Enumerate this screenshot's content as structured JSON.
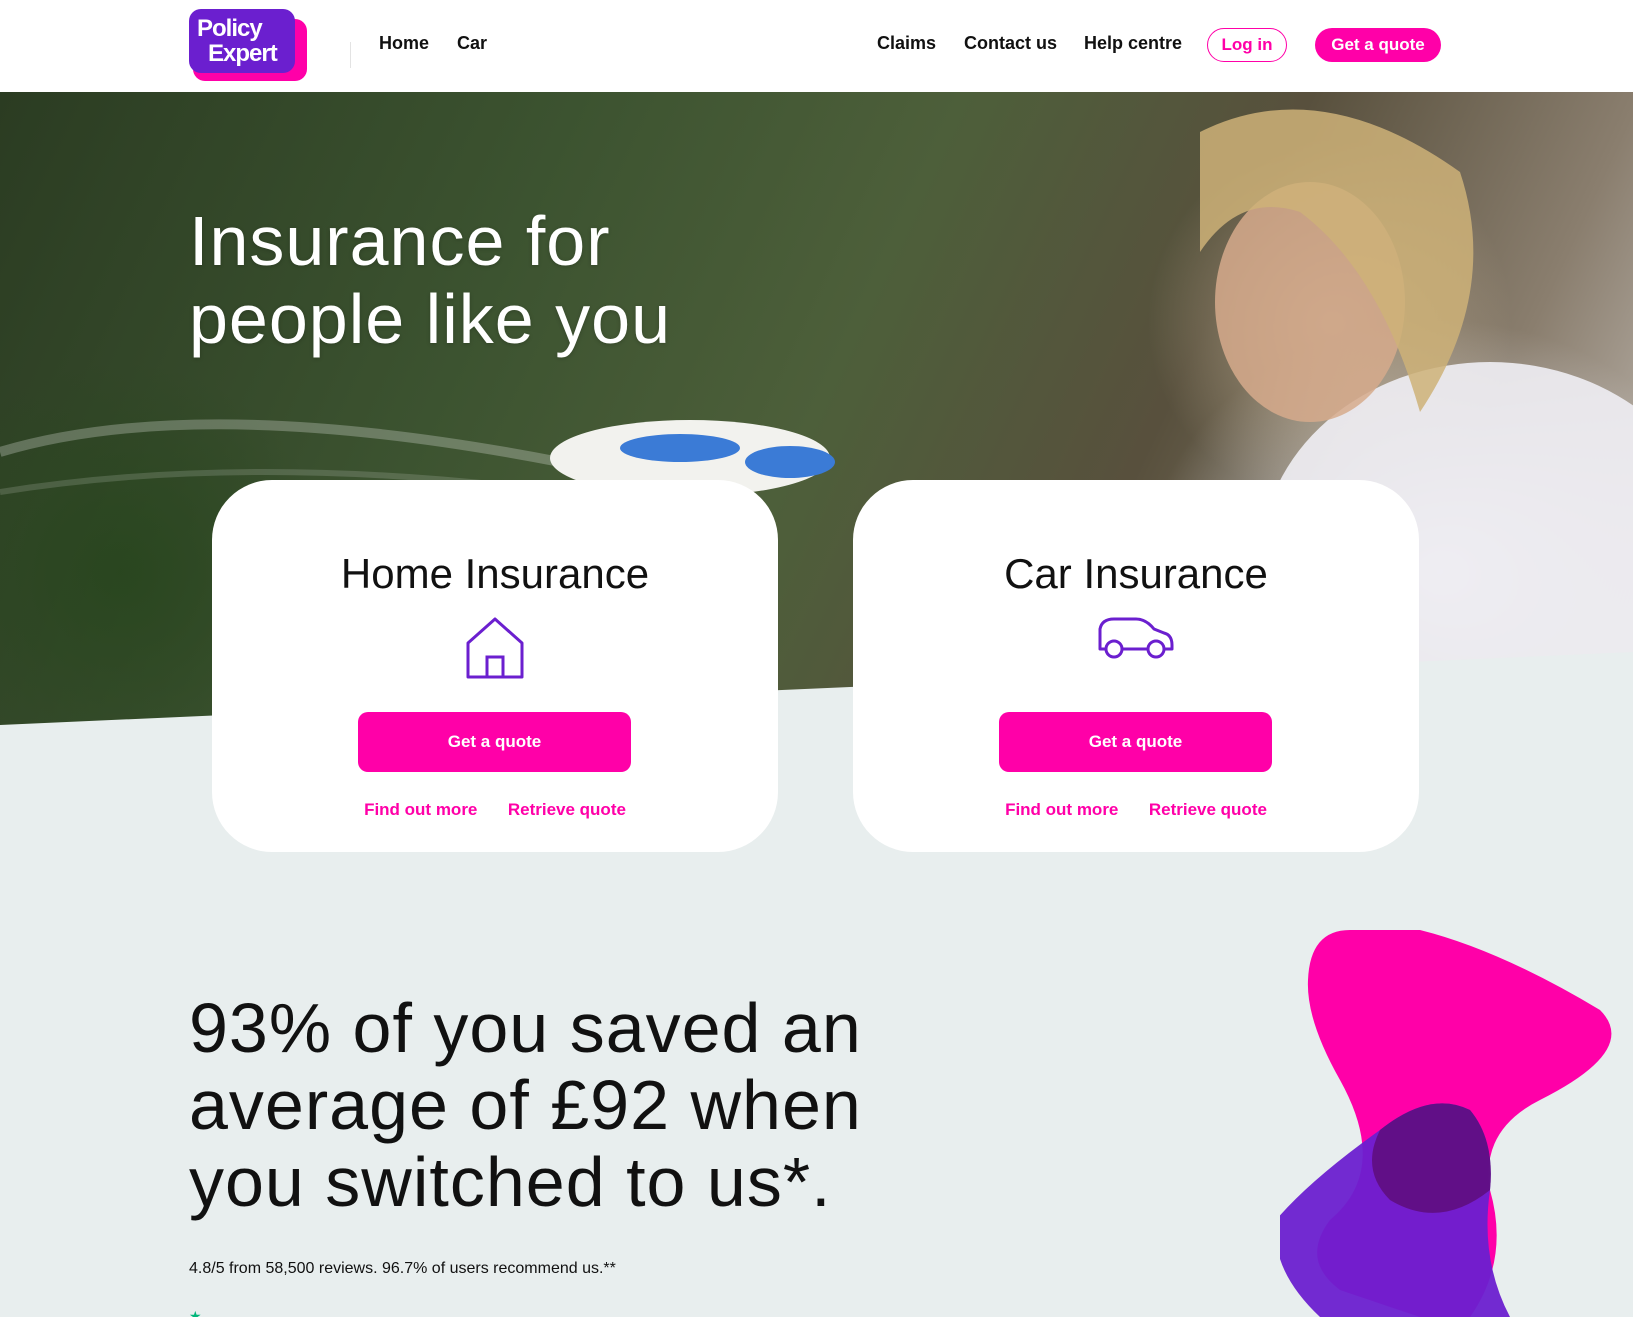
{
  "header": {
    "logo_line1": "Policy",
    "logo_line2": "Expert",
    "nav_left": [
      "Home",
      "Car"
    ],
    "nav_right": [
      "Claims",
      "Contact us",
      "Help centre"
    ],
    "login_label": "Log in",
    "quote_label": "Get a quote"
  },
  "hero": {
    "title_line1": "Insurance for",
    "title_line2": "people like you"
  },
  "cards": [
    {
      "title": "Home Insurance",
      "icon": "house-icon",
      "button": "Get a quote",
      "link1": "Find out more",
      "link2": "Retrieve quote"
    },
    {
      "title": "Car Insurance",
      "icon": "car-icon",
      "button": "Get a quote",
      "link1": "Find out more",
      "link2": "Retrieve quote"
    }
  ],
  "stat": {
    "line1": "93% of you saved an",
    "line2": "average of £92 when",
    "line3": "you switched to us*."
  },
  "reviews": "4.8/5 from 58,500 reviews. 96.7% of users recommend us.**",
  "colors": {
    "accent": "#ff00a8",
    "purple": "#6b1fcf",
    "page_bg": "#e8eeee"
  }
}
